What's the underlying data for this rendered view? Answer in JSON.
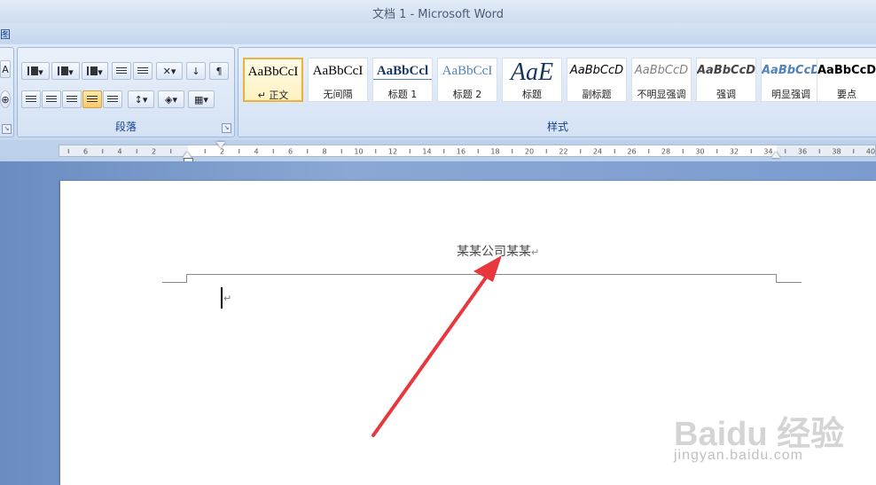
{
  "window": {
    "title": "文档 1 - Microsoft Word"
  },
  "tabs": {
    "partial_label": "图"
  },
  "paragraph_group": {
    "label": "段落",
    "launcher": "↘"
  },
  "styles_group": {
    "label": "样式",
    "items": [
      {
        "sample": "AaBbCcI",
        "label": "↵ 正文",
        "selected": true
      },
      {
        "sample": "AaBbCcI",
        "label": "无间隔"
      },
      {
        "sample": "AaBbCcl",
        "label": "标题 1"
      },
      {
        "sample": "AaBbCcI",
        "label": "标题 2"
      },
      {
        "sample": "AaE",
        "label": "标题"
      },
      {
        "sample": "AaBbCcD",
        "label": "副标题"
      },
      {
        "sample": "AaBbCcD",
        "label": "不明显强调"
      },
      {
        "sample": "AaBbCcD",
        "label": "强调"
      },
      {
        "sample": "AaBbCcD",
        "label": "明显强调"
      },
      {
        "sample": "AaBbCcD",
        "label": "要点"
      }
    ]
  },
  "ruler": {
    "left_numbers": [
      "6",
      "4",
      "2"
    ],
    "right_numbers": [
      "2",
      "4",
      "6",
      "8",
      "10",
      "12",
      "14",
      "16",
      "18",
      "20",
      "22",
      "24",
      "26",
      "28",
      "30",
      "32",
      "34",
      "36",
      "38",
      "40"
    ]
  },
  "document": {
    "header_text": "某某公司某某",
    "header_mark": "↵",
    "body_mark": "↵"
  },
  "watermark": {
    "logo": "Baidu 经验",
    "url": "jingyan.baidu.com"
  },
  "colors": {
    "arrow": "#e8383d",
    "ribbon_text": "#15428b"
  }
}
